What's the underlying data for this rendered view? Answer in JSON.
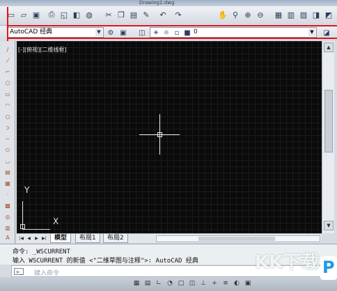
{
  "window": {
    "title": "Drawing1.dwg"
  },
  "toolbar2": {
    "workspace_value": "AutoCAD 经典",
    "layer_value": "0"
  },
  "viewport": {
    "label": "[-][俯视][二维线框]",
    "ucs_y": "Y",
    "ucs_x": "X"
  },
  "tabs": [
    {
      "label": "模型"
    },
    {
      "label": "布局1"
    },
    {
      "label": "布局2"
    }
  ],
  "command": {
    "line1": "命令: _WSCURRENT",
    "line2": "输入 WSCURRENT 的新值 <\"二维草图与注释\">: AutoCAD 经典",
    "placeholder": "键入命令"
  },
  "watermark": {
    "text": "KK下载",
    "logo": "P"
  },
  "colors": {
    "highlight": "#e3131b",
    "canvas": "#0a0a0a",
    "accent": "#1e9be8"
  },
  "icons": {
    "toolbar1": [
      "new-icon",
      "open-icon",
      "save-icon",
      "print-icon",
      "preview-icon",
      "publish-icon",
      "plot-icon",
      "cut-icon",
      "copy-icon",
      "paste-icon",
      "match-icon",
      "undo-icon",
      "redo-icon",
      "pan-icon",
      "zoom-icon",
      "zoom-window-icon",
      "zoom-prev-icon",
      "properties-icon",
      "design-center-icon",
      "tool-palette-icon",
      "sheet-set-icon",
      "markup-icon",
      "calc-icon",
      "help-icon"
    ]
  }
}
